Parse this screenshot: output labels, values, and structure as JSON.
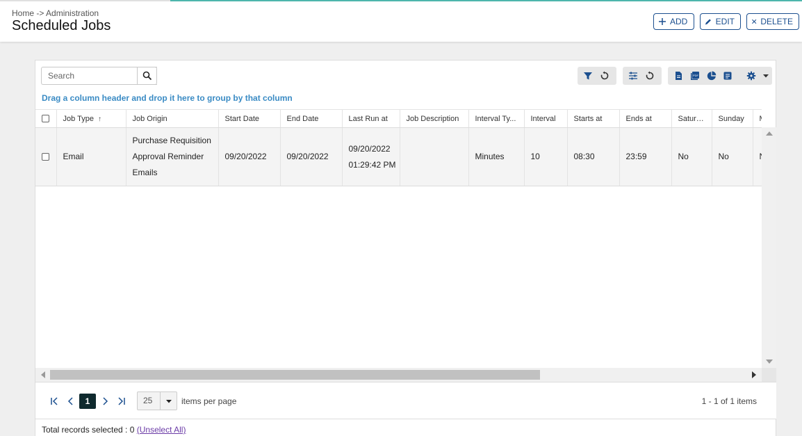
{
  "header": {
    "breadcrumb": "Home -> Administration",
    "title": "Scheduled Jobs",
    "buttons": {
      "add": "ADD",
      "edit": "EDIT",
      "delete": "DELETE"
    },
    "accent_color": "#1b4f8f"
  },
  "toolbar": {
    "search_placeholder": "Search",
    "icons": [
      "filter-icon",
      "reset-icon",
      "columns-icon",
      "reset-icon",
      "export-doc-icon",
      "export-pdf-icon",
      "chart-icon",
      "report-icon",
      "settings-icon"
    ]
  },
  "group_hint": "Drag a column header and drop it here to group by that column",
  "grid": {
    "columns": [
      "Job Type",
      "Job Origin",
      "Start Date",
      "End Date",
      "Last Run at",
      "Job Description",
      "Interval Ty...",
      "Interval",
      "Starts at",
      "Ends at",
      "Saturd...",
      "Sunday",
      "M"
    ],
    "sort_column": "Job Type",
    "sort_indicator": "↑",
    "rows": [
      {
        "job_type": "Email",
        "job_origin": [
          "Purchase Requisition",
          "Approval Reminder",
          "Emails"
        ],
        "start_date": "09/20/2022",
        "end_date": "09/20/2022",
        "last_run_at": [
          "09/20/2022",
          "01:29:42 PM"
        ],
        "job_description": "",
        "interval_type": "Minutes",
        "interval": "10",
        "starts_at": "08:30",
        "ends_at": "23:59",
        "saturday": "No",
        "sunday": "No",
        "monday": "N"
      }
    ]
  },
  "pager": {
    "current_page": "1",
    "page_size": "25",
    "items_per_page_label": "items per page",
    "info": "1 - 1 of 1 items"
  },
  "footer": {
    "selected_label": "Total records selected : 0",
    "unselect_all": "(Unselect All)"
  }
}
